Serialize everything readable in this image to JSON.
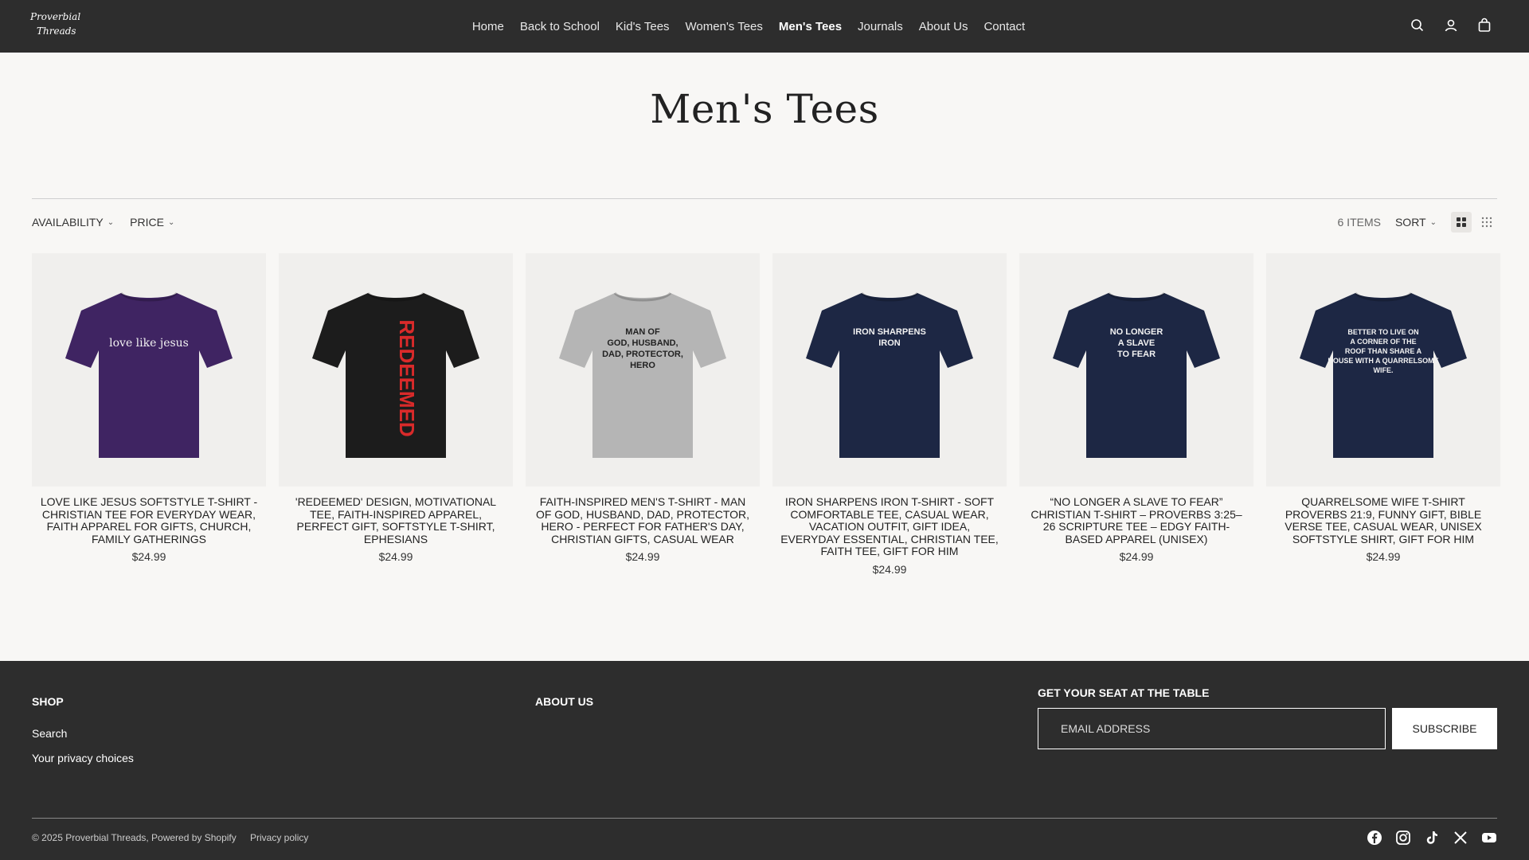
{
  "brand": {
    "logo_line1": "Proverbial",
    "logo_line2": "Threads"
  },
  "nav": [
    {
      "label": "Home",
      "active": false
    },
    {
      "label": "Back to School",
      "active": false
    },
    {
      "label": "Kid's Tees",
      "active": false
    },
    {
      "label": "Women's Tees",
      "active": false
    },
    {
      "label": "Men's Tees",
      "active": true
    },
    {
      "label": "Journals",
      "active": false
    },
    {
      "label": "About Us",
      "active": false
    },
    {
      "label": "Contact",
      "active": false
    }
  ],
  "header_icons": [
    "search-icon",
    "account-icon",
    "cart-icon"
  ],
  "page": {
    "title": "Men's Tees"
  },
  "toolbar": {
    "availability_label": "AVAILABILITY",
    "price_label": "PRICE",
    "items_count": "6 ITEMS",
    "sort_label": "SORT",
    "active_view": "grid-large"
  },
  "products": [
    {
      "name": "LOVE LIKE JESUS SOFTSTYLE T-SHIRT - CHRISTIAN TEE FOR EVERYDAY WEAR, FAITH APPAREL FOR GIFTS, CHURCH, FAMILY GATHERINGS",
      "price": "$24.99",
      "shirt_color": "#3f2462",
      "print_text": "love like jesus"
    },
    {
      "name": "'REDEEMED' DESIGN, MOTIVATIONAL TEE, FAITH-INSPIRED APPAREL, PERFECT GIFT, SOFTSTYLE T-SHIRT, EPHESIANS",
      "price": "$24.99",
      "shirt_color": "#1c1c1c",
      "print_text": "REDEEMED"
    },
    {
      "name": "FAITH-INSPIRED MEN'S T-SHIRT - MAN OF GOD, HUSBAND, DAD, PROTECTOR, HERO - PERFECT FOR FATHER'S DAY, CHRISTIAN GIFTS, CASUAL WEAR",
      "price": "$24.99",
      "shirt_color": "#b5b5b5",
      "print_text": "MAN OF GOD, HUSBAND, DAD, PROTECTOR, HERO"
    },
    {
      "name": "IRON SHARPENS IRON T-SHIRT - SOFT COMFORTABLE TEE, CASUAL WEAR, VACATION OUTFIT, GIFT IDEA, EVERYDAY ESSENTIAL, CHRISTIAN TEE, FAITH TEE, GIFT FOR HIM",
      "price": "$24.99",
      "shirt_color": "#1d2744",
      "print_text": "IRON SHARPENS IRON"
    },
    {
      "name": "“NO LONGER A SLAVE TO FEAR” CHRISTIAN T-SHIRT – PROVERBS 3:25–26 SCRIPTURE TEE – EDGY FAITH-BASED APPAREL (UNISEX)",
      "price": "$24.99",
      "shirt_color": "#1d2744",
      "print_text": "NO LONGER A SLAVE TO FEAR"
    },
    {
      "name": "QUARRELSOME WIFE T-SHIRT PROVERBS 21:9, FUNNY GIFT, BIBLE VERSE TEE, CASUAL WEAR, UNISEX SOFTSTYLE SHIRT, GIFT FOR HIM",
      "price": "$24.99",
      "shirt_color": "#1d2744",
      "print_text": "BETTER TO LIVE ON A CORNER OF THE ROOF THAN SHARE A HOUSE WITH A QUARRELSOME WIFE."
    }
  ],
  "footer": {
    "shop_heading": "SHOP",
    "shop_links": [
      "Search",
      "Your privacy choices"
    ],
    "about_heading": "ABOUT US",
    "newsletter_heading": "GET YOUR SEAT AT THE TABLE",
    "email_placeholder": "EMAIL ADDRESS",
    "subscribe_label": "SUBSCRIBE",
    "copyright": "© 2025 Proverbial Threads, Powered by Shopify",
    "privacy_policy": "Privacy policy",
    "socials": [
      "facebook-icon",
      "instagram-icon",
      "tiktok-icon",
      "x-icon",
      "youtube-icon"
    ]
  }
}
